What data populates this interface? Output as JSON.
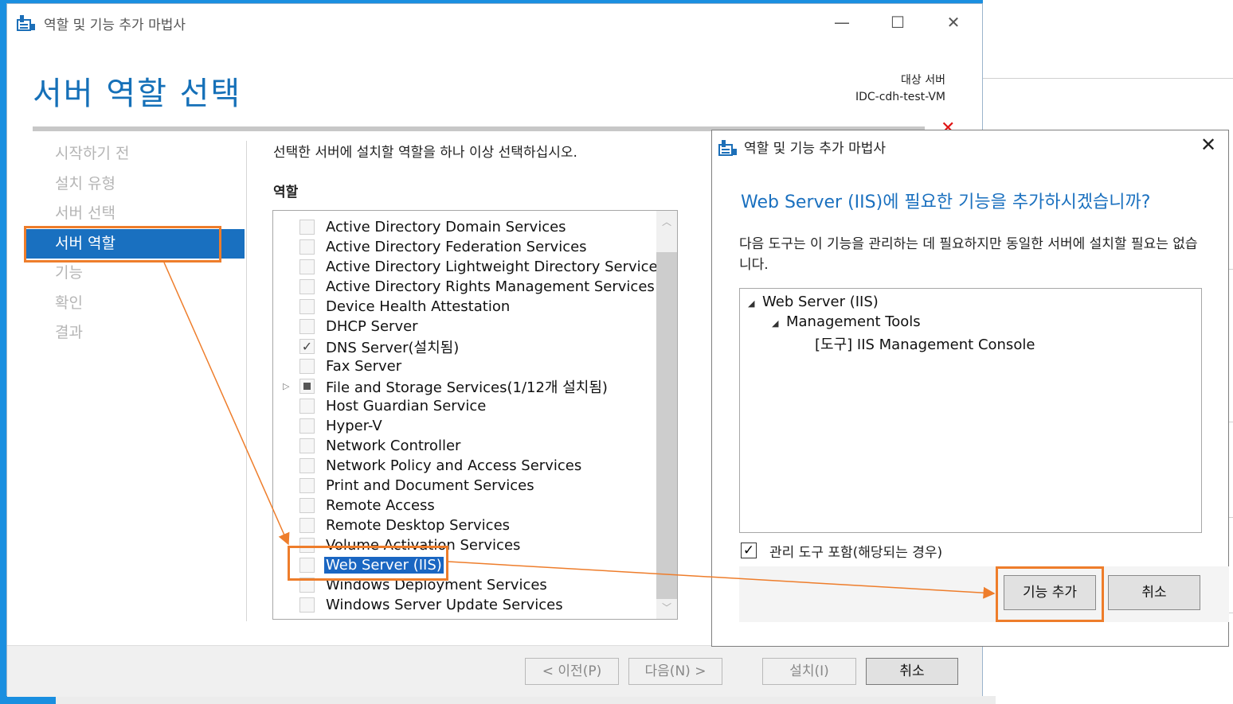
{
  "main_window": {
    "title": "역할 및 기능 추가 마법사",
    "minimize_glyph": "—",
    "maximize_glyph": "☐",
    "close_glyph": "✕",
    "page_title": "서버 역할 선택",
    "target_label": "대상 서버",
    "target_server": "IDC-cdh-test-VM",
    "warning_glyph": "✕"
  },
  "nav": {
    "items": [
      "시작하기 전",
      "설치 유형",
      "서버 선택",
      "서버 역할",
      "기능",
      "확인",
      "결과"
    ],
    "active": "서버 역할"
  },
  "content": {
    "instruction": "선택한 서버에 설치할 역할을 하나 이상 선택하십시오.",
    "roles_label": "역할",
    "roles": [
      {
        "label": "Active Directory Domain Services",
        "state": "unchecked"
      },
      {
        "label": "Active Directory Federation Services",
        "state": "unchecked"
      },
      {
        "label": "Active Directory Lightweight Directory Services",
        "state": "unchecked"
      },
      {
        "label": "Active Directory Rights Management Services",
        "state": "unchecked"
      },
      {
        "label": "Device Health Attestation",
        "state": "unchecked"
      },
      {
        "label": "DHCP Server",
        "state": "unchecked"
      },
      {
        "label": "DNS Server(설치됨)",
        "state": "checked"
      },
      {
        "label": "Fax Server",
        "state": "unchecked"
      },
      {
        "label": "File and Storage Services(1/12개 설치됨)",
        "state": "partial",
        "expandable": true
      },
      {
        "label": "Host Guardian Service",
        "state": "unchecked"
      },
      {
        "label": "Hyper-V",
        "state": "unchecked"
      },
      {
        "label": "Network Controller",
        "state": "unchecked"
      },
      {
        "label": "Network Policy and Access Services",
        "state": "unchecked"
      },
      {
        "label": "Print and Document Services",
        "state": "unchecked"
      },
      {
        "label": "Remote Access",
        "state": "unchecked"
      },
      {
        "label": "Remote Desktop Services",
        "state": "unchecked"
      },
      {
        "label": "Volume Activation Services",
        "state": "unchecked"
      },
      {
        "label": "Web Server (IIS)",
        "state": "unchecked",
        "selected": true
      },
      {
        "label": "Windows Deployment Services",
        "state": "unchecked"
      },
      {
        "label": "Windows Server Update Services",
        "state": "unchecked"
      }
    ]
  },
  "footer": {
    "prev": "< 이전(P)",
    "next": "다음(N) >",
    "install": "설치(I)",
    "cancel": "취소"
  },
  "dialog": {
    "title": "역할 및 기능 추가 마법사",
    "close_glyph": "✕",
    "heading": "Web Server (IIS)에 필요한 기능을 추가하시겠습니까?",
    "description": "다음 도구는 이 기능을 관리하는 데 필요하지만 동일한 서버에 설치할 필요는 없습니다.",
    "tree": [
      {
        "label": "Web Server (IIS)",
        "level": 0,
        "expanded": true
      },
      {
        "label": "Management Tools",
        "level": 1,
        "expanded": true
      },
      {
        "label": "[도구] IIS Management Console",
        "level": 2
      }
    ],
    "include_tools_label": "관리 도구 포함(해당되는 경우)",
    "include_tools_checked": true,
    "add_button": "기능 추가",
    "cancel_button": "취소"
  },
  "colors": {
    "accent": "#1970c0",
    "highlight": "#ee7d2b",
    "desktop": "#1a8fe0"
  }
}
